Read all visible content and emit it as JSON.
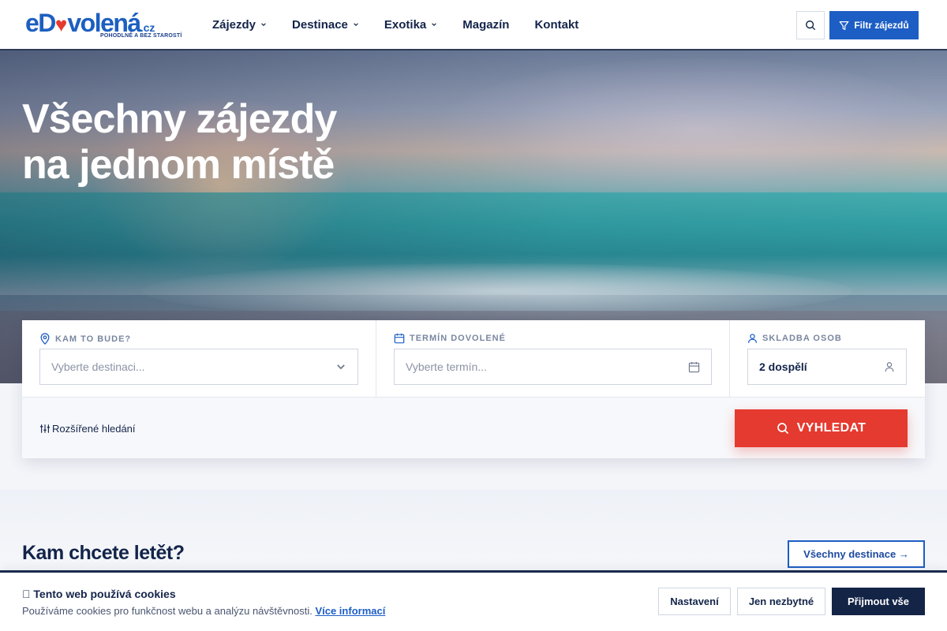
{
  "brand": {
    "logo_prefix": "eD",
    "logo_heart": "♥",
    "logo_suffix": "volená",
    "logo_tld": ".cz",
    "tagline": "POHODLNĚ A BEZ STAROSTÍ",
    "primary_color": "#1d5ec5",
    "accent_color": "#e53a2f"
  },
  "nav": {
    "items": [
      {
        "label": "Zájezdy",
        "has_dropdown": true
      },
      {
        "label": "Destinace",
        "has_dropdown": true
      },
      {
        "label": "Exotika",
        "has_dropdown": true
      },
      {
        "label": "Magazín",
        "has_dropdown": false
      },
      {
        "label": "Kontakt",
        "has_dropdown": false
      }
    ],
    "search_icon": "search-icon",
    "filter_label": "Filtr zájezdů"
  },
  "hero": {
    "title_line1": "Všechny zájezdy",
    "title_line2": "na jednom místě"
  },
  "search_form": {
    "destination": {
      "label": "KAM TO BUDE?",
      "placeholder": "Vyberte destinaci...",
      "icon": "map-pin-icon"
    },
    "date": {
      "label": "TERMÍN DOVOLENÉ",
      "placeholder": "Vyberte termín...",
      "icon": "calendar-icon"
    },
    "persons": {
      "label": "SKLADBA OSOB",
      "value": "2 dospělí",
      "icon": "user-icon"
    },
    "advanced_label": "Rozšířené hledání",
    "submit_label": "VYHLEDAT"
  },
  "section": {
    "title": "Kam chcete letět?",
    "all_destinations_label": "Všechny destinace →"
  },
  "cookie_bar": {
    "title": "Tento web používá cookies",
    "text": "Používáme cookies pro funkčnost webu a analýzu návštěvnosti.",
    "more_link": "Více informací",
    "settings_label": "Nastavení",
    "necessary_label": "Jen nezbytné",
    "accept_label": "Přijmout vše"
  }
}
